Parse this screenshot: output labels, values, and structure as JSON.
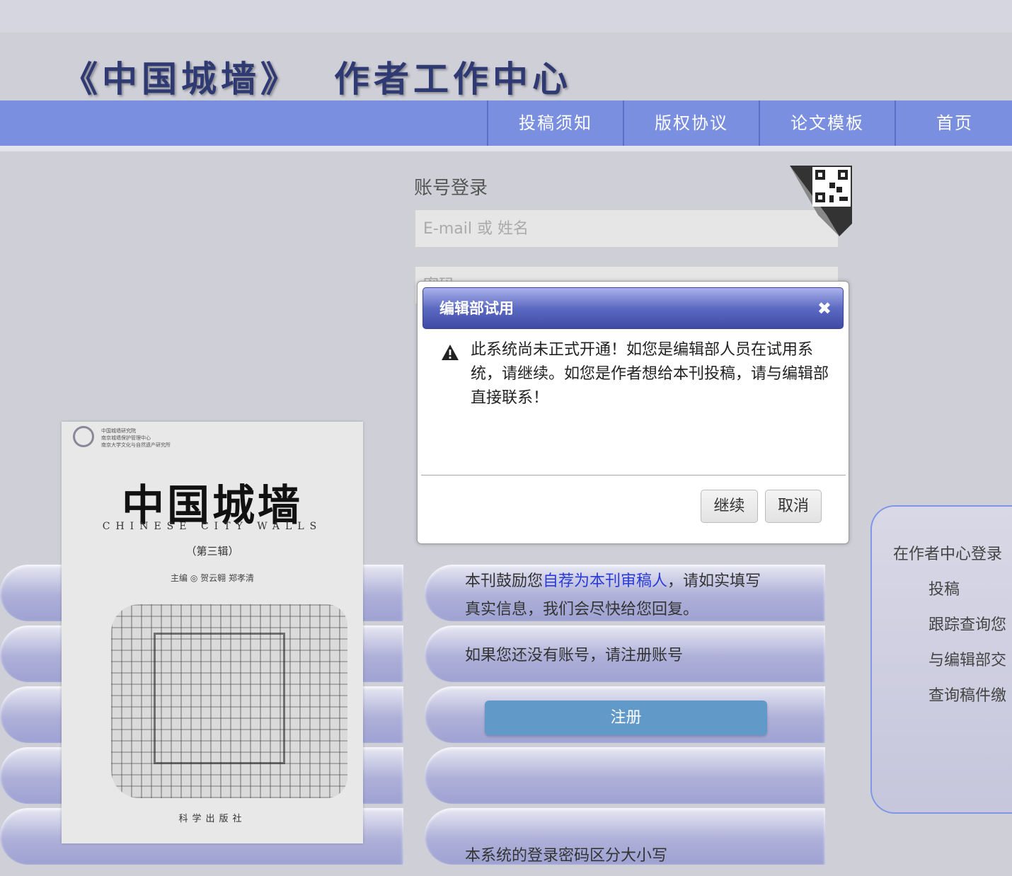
{
  "header": {
    "journal": "《中国城墙》",
    "center": "作者工作中心"
  },
  "nav": {
    "items": [
      "投稿须知",
      "版权协议",
      "论文模板",
      "首页"
    ]
  },
  "login": {
    "title": "账号登录",
    "email_placeholder": "E-mail 或 姓名",
    "password_placeholder": "密码"
  },
  "book": {
    "title": "中国城墙",
    "subtitle_en": "CHINESE CITY WALLS",
    "volume": "（第三辑）",
    "editors": "主编 ◎ 贺云翱  郑孝清",
    "publisher": "科学出版社",
    "orgs": [
      "中国城墙研究院",
      "南京城墙保护管理中心",
      "南京大学文化与自然遗产研究所"
    ]
  },
  "register": {
    "encourage_prefix": "本刊鼓励您",
    "encourage_link": "自荐为本刊审稿人",
    "encourage_suffix": "，请如实填写",
    "encourage_line2": "真实信息，我们会尽快给您回复。",
    "no_account": "如果您还没有账号，请注册账号",
    "button": "注册",
    "case_note": "本系统的登录密码区分大小写"
  },
  "right_panel": {
    "heading": "在作者中心登录",
    "items": [
      "投稿",
      "跟踪查询您",
      "与编辑部交",
      "查询稿件缴"
    ]
  },
  "dialog": {
    "title": "编辑部试用",
    "close_glyph": "✖",
    "message": "此系统尚未正式开通！如您是编辑部人员在试用系统，请继续。如您是作者想给本刊投稿，请与编辑部直接联系！",
    "continue_label": "继续",
    "cancel_label": "取消"
  }
}
